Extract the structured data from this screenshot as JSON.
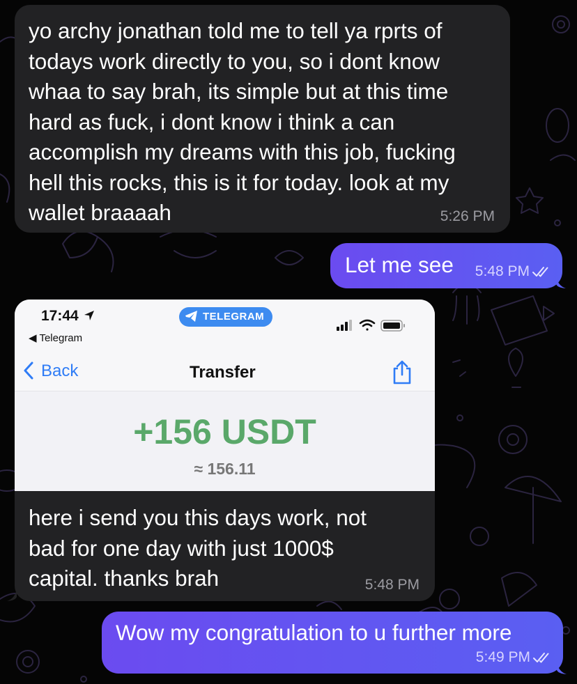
{
  "messages": [
    {
      "direction": "incoming",
      "text": "yo archy jonathan told me to tell ya rprts of\ntodays work directly to you, so i dont know\nwhaa  to say brah, its simple but at this time\nhard as fuck, i dont know i think a can\naccomplish my dreams with this job, fucking\nhell this rocks, this is it for today. look at my\nwallet braaaah",
      "time": "5:26 PM"
    },
    {
      "direction": "outgoing",
      "text": "Let me see",
      "time": "5:48 PM",
      "status_icon": "double-check-icon"
    },
    {
      "direction": "incoming",
      "screenshot": {
        "status_time": "17:44",
        "back_app": "Telegram",
        "pill_label": "TELEGRAM",
        "nav_back": "Back",
        "nav_title": "Transfer",
        "amount": "+156 USDT",
        "approx": "≈ 156.11",
        "amount_color": "#5aa86a",
        "link_color": "#2f7cf6"
      },
      "text": "here i send you this days work, not\nbad for one day with just 1000$\ncapital. thanks brah",
      "time": "5:48 PM"
    },
    {
      "direction": "outgoing",
      "text": "Wow my congratulation to u further more",
      "time": "5:49 PM",
      "status_icon": "double-check-icon"
    }
  ],
  "colors": {
    "incoming_bubble": "#222224",
    "outgoing_bubble": "#6b4bf0",
    "background": "#050505"
  }
}
